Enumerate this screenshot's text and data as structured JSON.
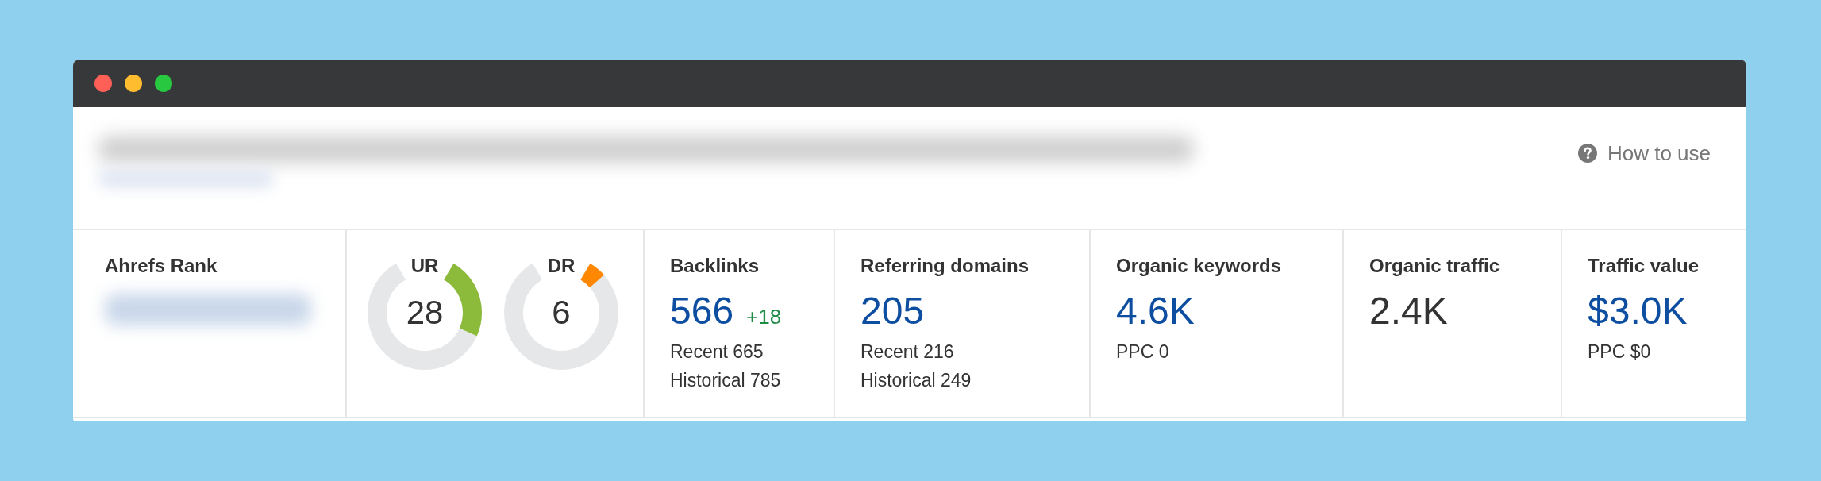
{
  "window": {
    "controls": [
      {
        "color": "#fe5f57"
      },
      {
        "color": "#febc2e"
      },
      {
        "color": "#28c840"
      }
    ]
  },
  "header": {
    "help_link": "How to use"
  },
  "metrics": [
    {
      "kind": "rank",
      "label": "Ahrefs Rank"
    },
    {
      "kind": "gauges",
      "gauges": [
        {
          "label": "UR",
          "value": "28",
          "level": 0.28,
          "color": "#8cba3a"
        },
        {
          "label": "DR",
          "value": "6",
          "level": 0.06,
          "color": "#ff8800"
        }
      ]
    },
    {
      "kind": "stat",
      "label": "Backlinks",
      "value": "566",
      "link": true,
      "change": "+18",
      "details": [
        "Recent 665",
        "Historical 785"
      ]
    },
    {
      "kind": "stat",
      "label": "Referring domains",
      "value": "205",
      "link": true,
      "details": [
        "Recent 216",
        "Historical 249"
      ]
    },
    {
      "kind": "stat",
      "label": "Organic keywords",
      "value": "4.6K",
      "link": true,
      "details": [
        "PPC 0"
      ]
    },
    {
      "kind": "stat",
      "label": "Organic traffic",
      "value": "2.4K",
      "link": false
    },
    {
      "kind": "stat",
      "label": "Traffic value",
      "value": "$3.0K",
      "link": true,
      "details": [
        "PPC $0"
      ]
    }
  ]
}
